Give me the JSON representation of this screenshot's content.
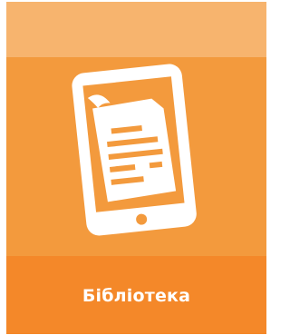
{
  "tile": {
    "label": "Бібліотека",
    "icon": "ebook-reader-icon"
  },
  "colors": {
    "top_band": "#f7b46e",
    "main": "#f39a3d",
    "label_band": "#f48829",
    "text": "#ffffff"
  }
}
